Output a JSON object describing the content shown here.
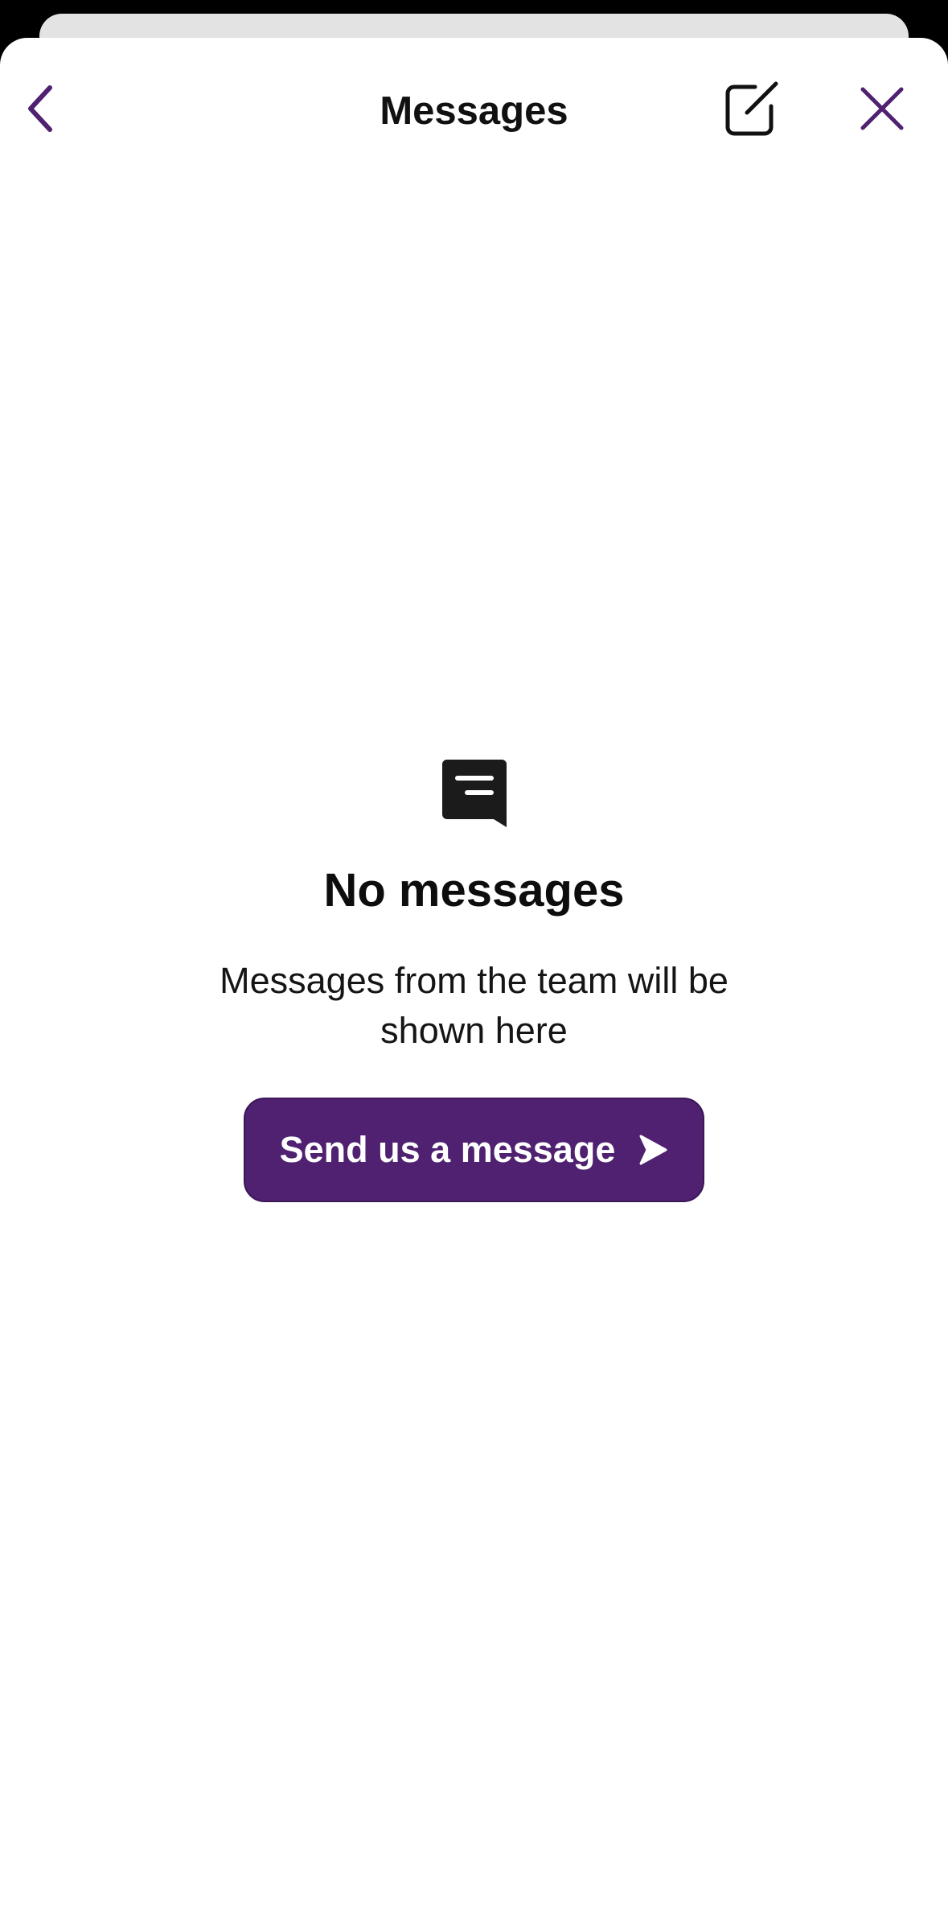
{
  "header": {
    "title": "Messages",
    "back_icon": "chevron-left-icon",
    "compose_icon": "compose-icon",
    "close_icon": "close-icon"
  },
  "empty_state": {
    "icon": "chat-bubble-icon",
    "title": "No messages",
    "subtitle": "Messages from the team will be shown here",
    "action_label": "Send us a message",
    "action_icon": "send-arrow-icon"
  },
  "colors": {
    "accent": "#4f2170",
    "background": "#ffffff",
    "backdrop": "#000000"
  }
}
